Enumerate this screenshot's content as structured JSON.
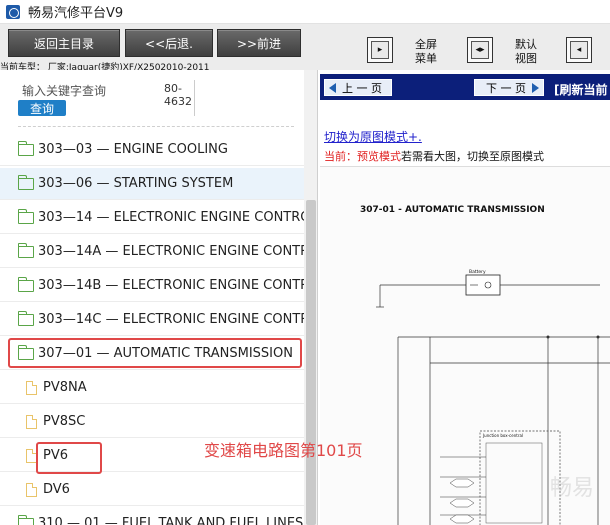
{
  "app": {
    "title": "畅易汽修平台V9"
  },
  "toolbar": {
    "back_main": "返回主目录",
    "back": "<<后退.",
    "forward": ">>前进",
    "full_menu_line1": "全屏",
    "full_menu_line2": "菜单",
    "default_view_line1": "默认",
    "default_view_line2": "视图",
    "car_info": "当前车型：  厂家:Jaguar(捷豹)XF/X2502010-2011"
  },
  "search": {
    "label": "输入关键字查询",
    "button": "查询",
    "code_line1": "80-",
    "code_line2": "4632"
  },
  "tree": {
    "items": [
      {
        "label": "303—03 — ENGINE COOLING",
        "type": "folder"
      },
      {
        "label": "303—06 — STARTING SYSTEM",
        "type": "folder"
      },
      {
        "label": "303—14 — ELECTRONIC ENGINE CONTRO",
        "type": "folder"
      },
      {
        "label": "303—14A — ELECTRONIC ENGINE CONTR",
        "type": "folder"
      },
      {
        "label": "303—14B — ELECTRONIC ENGINE CONTR",
        "type": "folder"
      },
      {
        "label": "303—14C — ELECTRONIC ENGINE CONTR",
        "type": "folder"
      },
      {
        "label": "307—01 — AUTOMATIC TRANSMISSION",
        "type": "folder"
      },
      {
        "label": "PV8NA",
        "type": "file"
      },
      {
        "label": "PV8SC",
        "type": "file"
      },
      {
        "label": "PV6",
        "type": "file"
      },
      {
        "label": "DV6",
        "type": "file"
      },
      {
        "label": "310 — 01 — FUEL TANK AND FUEL LINES",
        "type": "folder"
      }
    ]
  },
  "viewer": {
    "prev_page": "上 一 页",
    "next_page": "下 一 页",
    "refresh": "[刷新当前",
    "switch_link": "切换为原图模式+.",
    "mode_prefix": "当前：预览模式",
    "mode_suffix": "若需看大图，切换至原图模式",
    "doc_title": "307-01 - AUTOMATIC TRANSMISSION",
    "battery_label": "Battery",
    "junction_label": "Junction box-central"
  },
  "annotation": {
    "caption": "变速箱电路图第101页",
    "watermark": "畅易"
  },
  "colors": {
    "accent": "#1f7fc7",
    "nav_bar": "#0c1f7a",
    "highlight_red": "#e04848",
    "folder_green": "#5aa548",
    "file_yellow": "#e9c46a"
  }
}
